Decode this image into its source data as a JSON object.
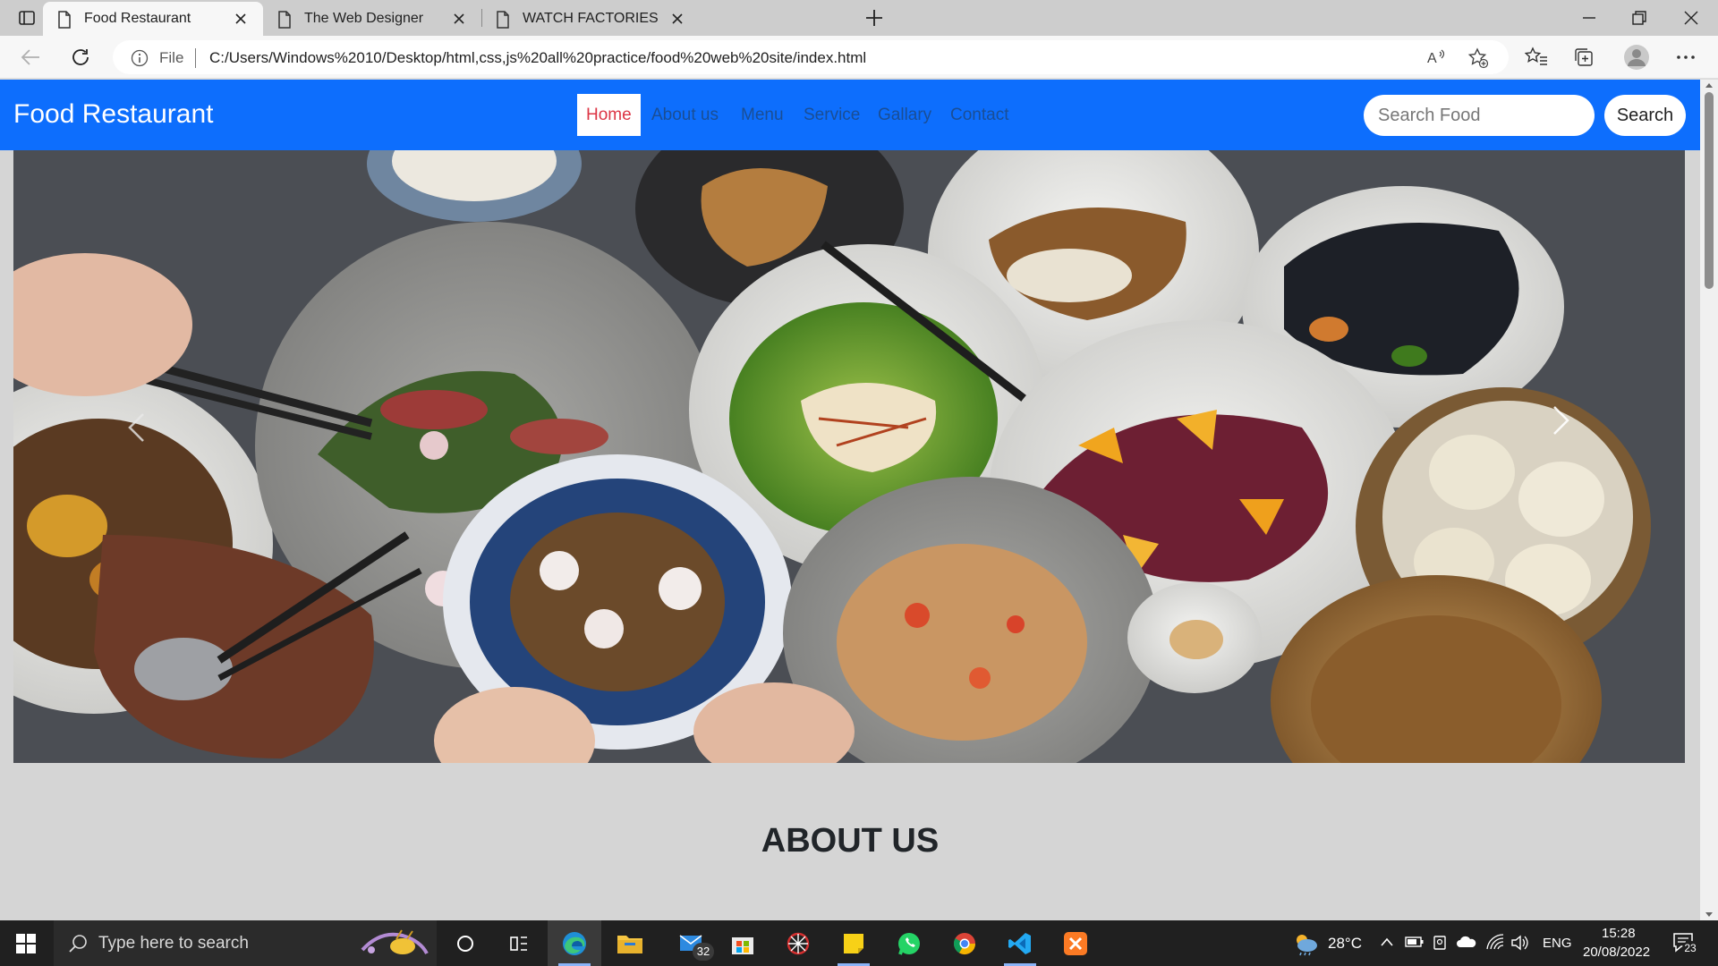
{
  "browser": {
    "tabs": [
      {
        "title": "Food Restaurant",
        "active": true
      },
      {
        "title": "The Web Designer",
        "active": false
      },
      {
        "title": "WATCH FACTORIES",
        "active": false
      }
    ],
    "address": {
      "scheme_label": "File",
      "url": "C:/Users/Windows%2010/Desktop/html,css,js%20all%20practice/food%20web%20site/index.html"
    }
  },
  "site": {
    "brand": "Food Restaurant",
    "nav": [
      {
        "label": "Home",
        "active": true
      },
      {
        "label": "About us",
        "active": false
      },
      {
        "label": "Menu",
        "active": false
      },
      {
        "label": "Service",
        "active": false
      },
      {
        "label": "Gallary",
        "active": false
      },
      {
        "label": "Contact",
        "active": false
      }
    ],
    "search": {
      "placeholder": "Search Food",
      "button_label": "Search"
    },
    "about_heading": "ABOUT US"
  },
  "taskbar": {
    "search_placeholder": "Type here to search",
    "mail_badge": "32",
    "weather": "28°C",
    "language": "ENG",
    "time": "15:28",
    "date": "20/08/2022",
    "notification_count": "23"
  },
  "colors": {
    "navbar": "#0d6efd",
    "active_link": "#dc3545",
    "nav_link": "#1a4e95",
    "page_bg": "#d5d5d5"
  }
}
